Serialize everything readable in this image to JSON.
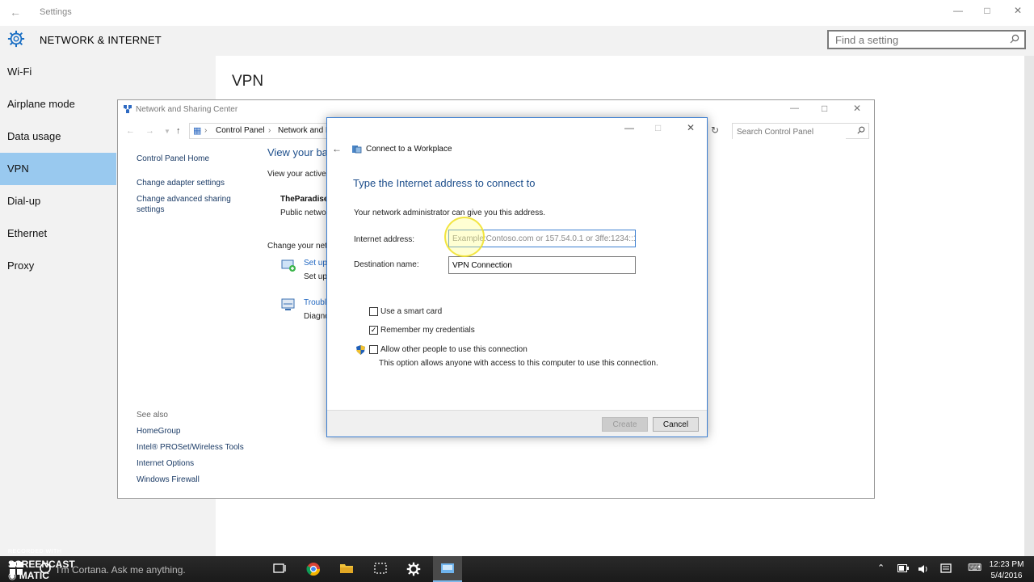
{
  "settings": {
    "window_title": "Settings",
    "category": "NETWORK & INTERNET",
    "search_placeholder": "Find a setting",
    "page_title": "VPN",
    "sidebar": [
      {
        "label": "Wi-Fi",
        "active": false
      },
      {
        "label": "Airplane mode",
        "active": false
      },
      {
        "label": "Data usage",
        "active": false
      },
      {
        "label": "VPN",
        "active": true
      },
      {
        "label": "Dial-up",
        "active": false
      },
      {
        "label": "Ethernet",
        "active": false
      },
      {
        "label": "Proxy",
        "active": false
      }
    ]
  },
  "nsc": {
    "window_title": "Network and Sharing Center",
    "breadcrumb": [
      "Control Panel",
      "Network and I"
    ],
    "search_placeholder": "Search Control Panel",
    "left_links": [
      "Control Panel Home",
      "Change adapter settings",
      "Change advanced sharing",
      "settings"
    ],
    "see_also": "See also",
    "see_also_links": [
      "HomeGroup",
      "Intel® PROSet/Wireless Tools",
      "Internet Options",
      "Windows Firewall"
    ],
    "heading": "View your ba",
    "active_label": "View your active",
    "network_name": "TheParadise",
    "network_type": "Public networ",
    "change_label": "Change your netw",
    "task1_link": "Set up",
    "task1_desc": "Set up",
    "task2_link": "Troubl",
    "task2_desc": "Diagno"
  },
  "dialog": {
    "window_title": "Connect to a Workplace",
    "heading": "Type the Internet address to connect to",
    "description": "Your network administrator can give you this address.",
    "address_label": "Internet address:",
    "address_placeholder": "Example:Contoso.com or 157.54.0.1 or 3ffe:1234::1",
    "address_value": "",
    "destination_label": "Destination name:",
    "destination_value": "VPN Connection",
    "options": [
      {
        "label": "Use a smart card",
        "checked": false
      },
      {
        "label": "Remember my credentials",
        "checked": true
      },
      {
        "label": "Allow other people to use this connection",
        "checked": false
      }
    ],
    "allow_note": "This option allows anyone with access to this computer to use this connection.",
    "create_label": "Create",
    "cancel_label": "Cancel"
  },
  "taskbar": {
    "cortana_placeholder": "I'm Cortana. Ask me anything.",
    "time": "12:23 PM",
    "date": "5/4/2016",
    "watermark_top": "RECORDED WITH",
    "watermark_brand": "SCREENCAST ◉ MATIC"
  },
  "colors": {
    "accent": "#99c9ef",
    "link": "#1e4f8c",
    "dialog_border": "#3d7fd1"
  }
}
